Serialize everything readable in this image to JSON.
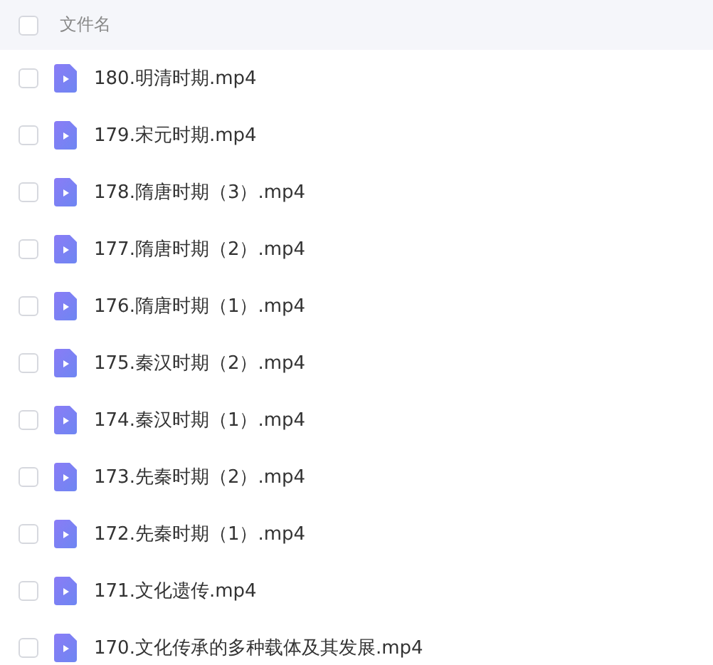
{
  "header": {
    "label": "文件名",
    "checked": false
  },
  "files": [
    {
      "name": "180.明清时期.mp4",
      "checked": false
    },
    {
      "name": "179.宋元时期.mp4",
      "checked": false
    },
    {
      "name": "178.隋唐时期（3）.mp4",
      "checked": false
    },
    {
      "name": "177.隋唐时期（2）.mp4",
      "checked": false
    },
    {
      "name": "176.隋唐时期（1）.mp4",
      "checked": false
    },
    {
      "name": "175.秦汉时期（2）.mp4",
      "checked": false
    },
    {
      "name": "174.秦汉时期（1）.mp4",
      "checked": false
    },
    {
      "name": "173.先秦时期（2）.mp4",
      "checked": false
    },
    {
      "name": "172.先秦时期（1）.mp4",
      "checked": false
    },
    {
      "name": "171.文化遗传.mp4",
      "checked": false
    },
    {
      "name": "170.文化传承的多种载体及其发展.mp4",
      "checked": false
    }
  ]
}
